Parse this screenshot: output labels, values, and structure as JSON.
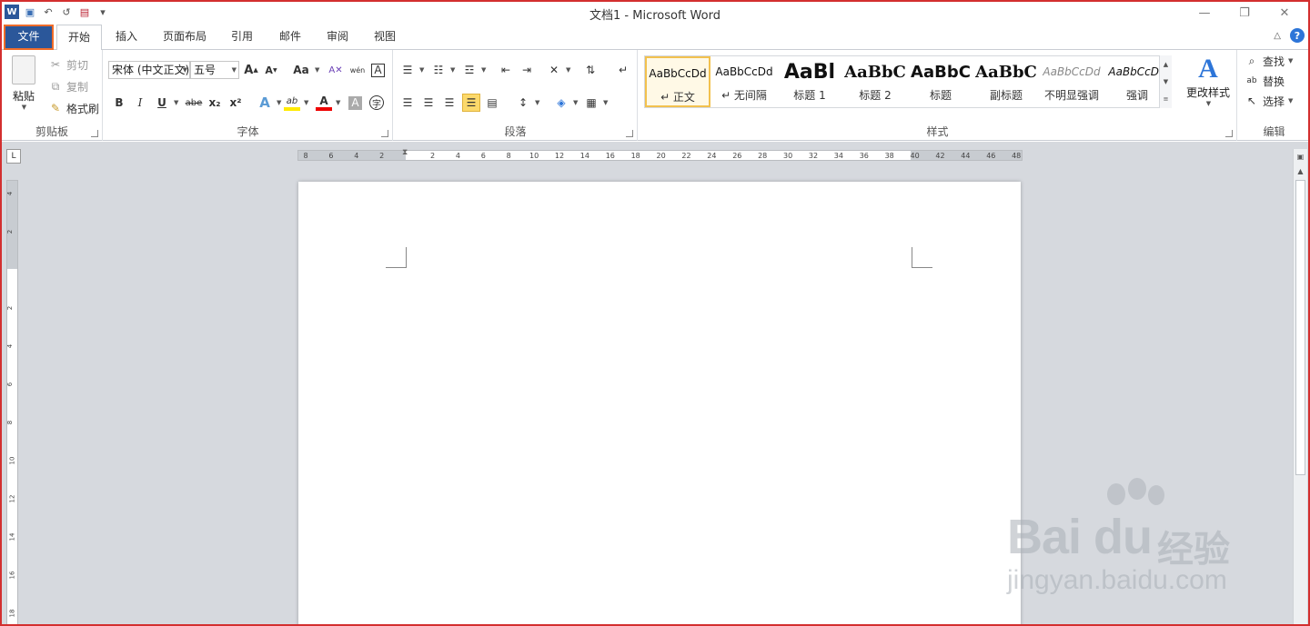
{
  "window": {
    "title": "文档1 - Microsoft Word",
    "controls": {
      "minimize": "—",
      "restore": "❐",
      "close": "✕"
    }
  },
  "qat": {
    "word_icon": "W",
    "save": "💾",
    "undo": "↶",
    "redo": "↺",
    "customize": "▾"
  },
  "tabs": [
    {
      "label": "文件"
    },
    {
      "label": "开始"
    },
    {
      "label": "插入"
    },
    {
      "label": "页面布局"
    },
    {
      "label": "引用"
    },
    {
      "label": "邮件"
    },
    {
      "label": "审阅"
    },
    {
      "label": "视图"
    }
  ],
  "clipboard": {
    "paste": "粘贴",
    "cut": "剪切",
    "copy": "复制",
    "format_painter": "格式刷",
    "label": "剪贴板"
  },
  "font": {
    "family": "宋体 (中文正文)",
    "size": "五号",
    "label": "字体",
    "buttons": {
      "bold": "B",
      "italic": "I",
      "underline": "U",
      "strike": "abe",
      "sub": "x₂",
      "sup": "x²",
      "grow": "A",
      "shrink": "A",
      "case": "Aa",
      "clear": "A",
      "pinyin": "wén",
      "char_border": "A",
      "text_effect": "A",
      "highlight": "ab",
      "font_color": "A",
      "shade": "A",
      "enclose": "字"
    }
  },
  "paragraph": {
    "label": "段落"
  },
  "styles": {
    "label": "样式",
    "items": [
      {
        "sample": "AaBbCcDd",
        "name": "↵ 正文"
      },
      {
        "sample": "AaBbCcDd",
        "name": "↵ 无间隔"
      },
      {
        "sample": "AaBl",
        "name": "标题 1"
      },
      {
        "sample": "AaBbC",
        "name": "标题 2"
      },
      {
        "sample": "AaBbC",
        "name": "标题"
      },
      {
        "sample": "AaBbC",
        "name": "副标题"
      },
      {
        "sample": "AaBbCcDd",
        "name": "不明显强调"
      },
      {
        "sample": "AaBbCcDd",
        "name": "强调"
      }
    ],
    "change_styles": "更改样式"
  },
  "editing": {
    "find": "查找",
    "replace": "替换",
    "select": "选择",
    "label": "编辑"
  },
  "ruler": {
    "h_ticks": [
      "8",
      "6",
      "4",
      "2",
      "",
      "2",
      "4",
      "6",
      "8",
      "10",
      "12",
      "14",
      "16",
      "18",
      "20",
      "22",
      "24",
      "26",
      "28",
      "30",
      "32",
      "34",
      "36",
      "38",
      "40",
      "42",
      "44",
      "46",
      "48"
    ],
    "v_ticks": [
      "4",
      "2",
      "",
      "2",
      "4",
      "6",
      "8",
      "10",
      "12",
      "14",
      "16",
      "18"
    ],
    "corner": "L"
  },
  "watermark": {
    "logo": "Bai  du",
    "jingyan": "经验",
    "url": "jingyan.baidu.com"
  },
  "colors": {
    "file_tab": "#2b579a",
    "highlight_frame": "#ef6c2a",
    "accent_red": "#d32f2f"
  }
}
